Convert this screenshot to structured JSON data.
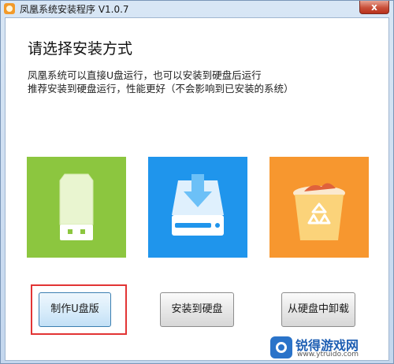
{
  "window": {
    "title": "凤凰系统安装程序 V1.0.7",
    "close_label": "x"
  },
  "content": {
    "heading": "请选择安装方式",
    "description_line1": "凤凰系统可以直接U盘运行，也可以安装到硬盘后运行",
    "description_line2": "推荐安装到硬盘运行，性能更好（不会影响到已安装的系统）"
  },
  "options": [
    {
      "icon": "usb-drive-icon",
      "color": "#8cc63f",
      "button_label": "制作U盘版"
    },
    {
      "icon": "install-to-disk-icon",
      "color": "#1f95ec",
      "button_label": "安装到硬盘"
    },
    {
      "icon": "recycle-bin-icon",
      "color": "#f7972f",
      "button_label": "从硬盘中卸载"
    }
  ],
  "watermark": {
    "name": "锐得游戏网",
    "url": "www.ytruido.com"
  }
}
